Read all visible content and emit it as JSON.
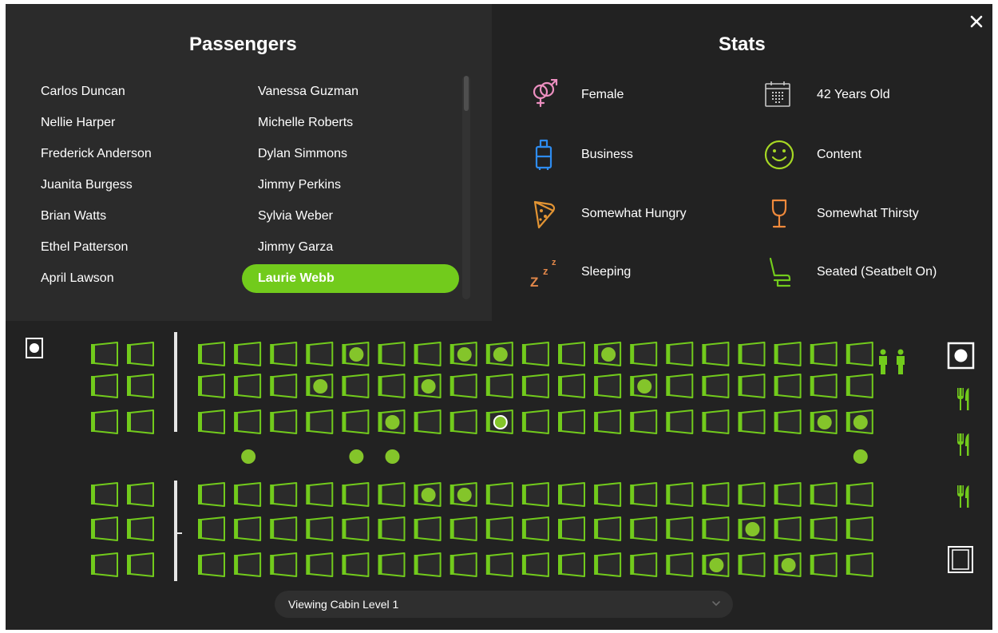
{
  "passengers_panel": {
    "title": "Passengers",
    "names": [
      "Carlos Duncan",
      "Nellie Harper",
      "Frederick Anderson",
      "Juanita Burgess",
      "Brian Watts",
      "Ethel Patterson",
      "April Lawson",
      "Vanessa Guzman",
      "Michelle Roberts",
      "Dylan Simmons",
      "Jimmy Perkins",
      "Sylvia Weber",
      "Jimmy Garza",
      "Laurie Webb"
    ],
    "selected": "Laurie Webb"
  },
  "stats_panel": {
    "title": "Stats",
    "items": [
      {
        "label": "Female",
        "icon": "gender-icon",
        "color": "#ec8fc0"
      },
      {
        "label": "42 Years Old",
        "icon": "calendar-icon",
        "color": "#c8c8c8"
      },
      {
        "label": "Business",
        "icon": "luggage-icon",
        "color": "#2e8cf0"
      },
      {
        "label": "Content",
        "icon": "smiley-icon",
        "color": "#a6d824"
      },
      {
        "label": "Somewhat Hungry",
        "icon": "pizza-icon",
        "color": "#e39433"
      },
      {
        "label": "Somewhat Thirsty",
        "icon": "wine-glass-icon",
        "color": "#f08a3c"
      },
      {
        "label": "Sleeping",
        "icon": "sleeping-zzz-icon",
        "color": "#e3884a"
      },
      {
        "label": "Seated (Seatbelt On)",
        "icon": "seat-icon",
        "color": "#72cb1c"
      }
    ]
  },
  "close_icon": "close-icon",
  "cabin": {
    "seat_color": "#72cb1c",
    "passenger_color": "#84c52a",
    "rows_per_block": 3,
    "left_columns": 2,
    "main_columns": 19,
    "upper_occupied": [
      [
        4,
        7,
        8,
        11
      ],
      [
        3,
        6,
        12
      ],
      [
        5,
        8,
        17,
        18
      ]
    ],
    "upper_left_occupied": [
      [],
      [],
      []
    ],
    "lower_occupied": [
      [
        6,
        7
      ],
      [
        15
      ],
      [
        14,
        16
      ]
    ],
    "lower_left_occupied": [
      [],
      [],
      []
    ],
    "selected_seat": {
      "block": "upper",
      "row": 2,
      "col": 8
    },
    "aisle_passengers": [
      1,
      4,
      5,
      18
    ],
    "amenities": {
      "left": [
        "galley-icon"
      ],
      "right": [
        "restroom-icon",
        "galley-icon",
        "food-icon",
        "food-icon",
        "food-icon",
        "storage-icon"
      ]
    }
  },
  "level_selector": {
    "label": "Viewing Cabin Level 1",
    "icon": "chevron-down-icon"
  }
}
